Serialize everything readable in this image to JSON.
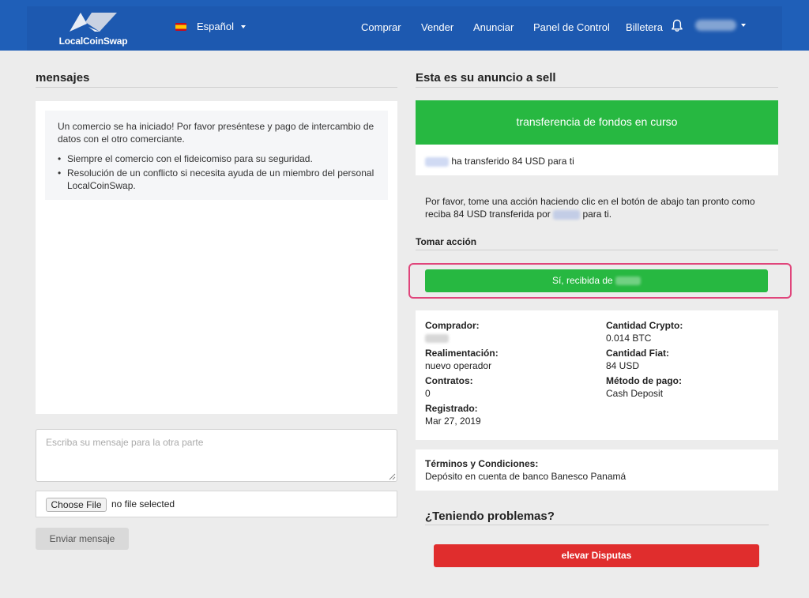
{
  "header": {
    "brand": "LocalCoinSwap",
    "language": "Español",
    "nav": [
      "Comprar",
      "Vender",
      "Anunciar",
      "Panel de Control",
      "Billetera"
    ],
    "colors": {
      "bar": "#1f5fb8",
      "text": "#ffffff"
    }
  },
  "messages": {
    "title": "mensajes",
    "notice_intro": "Un comercio se ha iniciado! Por favor preséntese y pago de intercambio de datos con el otro comerciante.",
    "bullets": [
      "Siempre el comercio con el fideicomiso para su seguridad.",
      "Resolución de un conflicto si necesita ayuda de un miembro del personal LocalCoinSwap."
    ],
    "input_placeholder": "Escriba su mensaje para la otra parte",
    "choose_file": "Choose File",
    "file_status": "no file selected",
    "send_label": "Enviar mensaje"
  },
  "trade": {
    "title": "Esta es su anuncio a sell",
    "status_banner": "transferencia de fondos en curso",
    "transfer_text": "ha transferido 84 USD para ti",
    "instruction_part1": "Por favor, tome una acción haciendo clic en el botón de abajo tan pronto como reciba 84 USD transferida por",
    "instruction_part2": "para ti.",
    "take_action": "Tomar acción",
    "confirm_label": "Sí, recibida de",
    "details": {
      "buyer_label": "Comprador:",
      "feedback_label": "Realimentación:",
      "feedback_value": "nuevo operador",
      "contracts_label": "Contratos:",
      "contracts_value": "0",
      "registered_label": "Registrado:",
      "registered_value": "Mar 27, 2019",
      "crypto_label": "Cantidad Crypto:",
      "crypto_value": "0.014 BTC",
      "fiat_label": "Cantidad Fiat:",
      "fiat_value": "84 USD",
      "payment_label": "Método de pago:",
      "payment_value": "Cash Deposit"
    },
    "terms_label": "Términos y Condiciones:",
    "terms_value": "Depósito en cuenta de banco Banesco Panamá",
    "problems_title": "¿Teniendo problemas?",
    "dispute_label": "elevar Disputas",
    "colors": {
      "green": "#27b841",
      "red": "#e02d2d",
      "highlight": "#e0457b"
    }
  }
}
